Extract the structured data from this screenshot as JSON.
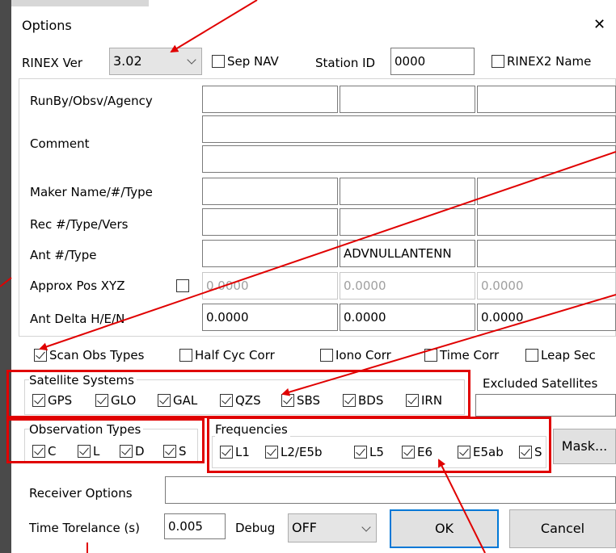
{
  "title": "Options",
  "close_glyph": "✕",
  "top": {
    "rinex_ver_label": "RINEX Ver",
    "rinex_ver_value": "3.02",
    "sep_nav": "Sep NAV",
    "station_id_label": "Station ID",
    "station_id_value": "0000",
    "rinex2_name": "RINEX2 Name"
  },
  "header_rows": {
    "runby": "RunBy/Obsv/Agency",
    "comment": "Comment",
    "maker": "Maker Name/#/Type",
    "rec": "Rec #/Type/Vers",
    "ant": "Ant #/Type",
    "ant_type_value": "ADVNULLANTENN",
    "approx_pos": "Approx Pos XYZ",
    "approx_x": "0.0000",
    "approx_y": "0.0000",
    "approx_z": "0.0000",
    "ant_delta": "Ant Delta H/E/N",
    "delta_h": "0.0000",
    "delta_e": "0.0000",
    "delta_n": "0.0000"
  },
  "options_row": {
    "scan_obs": "Scan Obs Types",
    "half_cyc": "Half Cyc Corr",
    "iono": "Iono Corr",
    "time_corr": "Time Corr",
    "leap_sec": "Leap Sec"
  },
  "satellite_systems": {
    "label": "Satellite Systems",
    "items": [
      "GPS",
      "GLO",
      "GAL",
      "QZS",
      "SBS",
      "BDS",
      "IRN"
    ],
    "excluded_label": "Excluded Satellites"
  },
  "observation_types": {
    "label": "Observation Types",
    "items": [
      "C",
      "L",
      "D",
      "S"
    ]
  },
  "frequencies": {
    "label": "Frequencies",
    "items": [
      "L1",
      "L2/E5b",
      "L5",
      "E6",
      "E5ab",
      "S"
    ],
    "mask_button": "Mask..."
  },
  "bottom": {
    "receiver_options": "Receiver Options",
    "time_tolerance_label": "Time Torelance (s)",
    "time_tolerance_value": "0.005",
    "debug_label": "Debug",
    "debug_value": "OFF",
    "ok": "OK",
    "cancel": "Cancel"
  },
  "colors": {
    "annotation_red": "#e00000",
    "ok_border": "#0078d7"
  }
}
